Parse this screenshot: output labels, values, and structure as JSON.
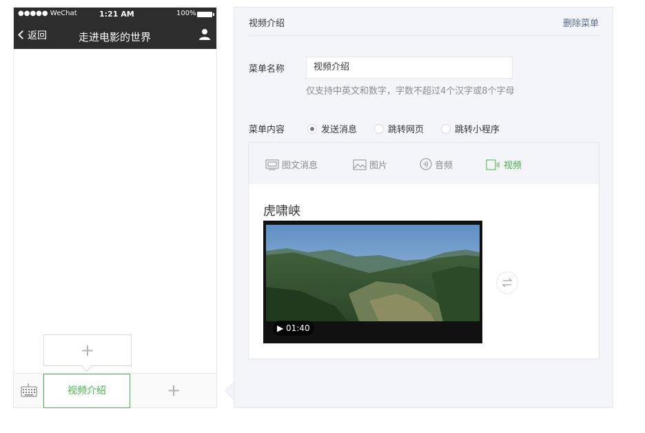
{
  "phone": {
    "status_bar": {
      "carrier": "●●●●● WeChat",
      "time": "1:21 AM",
      "battery": "100%"
    },
    "back_label": "返回",
    "title": "走进电影的世界",
    "menubar": {
      "active_item": "视频介绍",
      "add_symbol": "+",
      "submenu_add_symbol": "+"
    }
  },
  "editor": {
    "title": "视频介绍",
    "delete_label": "删除菜单",
    "name_label": "菜单名称",
    "name_value": "视频介绍",
    "name_hint": "仅支持中英文和数字，字数不超过4个汉字或8个字母",
    "content_label": "菜单内容",
    "content_options": [
      {
        "label": "发送消息",
        "selected": true
      },
      {
        "label": "跳转网页",
        "selected": false
      },
      {
        "label": "跳转小程序",
        "selected": false
      }
    ],
    "tabs": [
      {
        "label": "图文消息",
        "icon": "news-icon",
        "active": false
      },
      {
        "label": "图片",
        "icon": "image-icon",
        "active": false
      },
      {
        "label": "音频",
        "icon": "audio-icon",
        "active": false
      },
      {
        "label": "视频",
        "icon": "video-icon",
        "active": true
      }
    ],
    "video": {
      "title": "虎啸峡",
      "duration": "▶ 01:40"
    }
  },
  "colors": {
    "accent": "#44b549",
    "link": "#576b95",
    "header_bg": "#2d2d2d",
    "panel_bg": "#f4f5f9"
  }
}
